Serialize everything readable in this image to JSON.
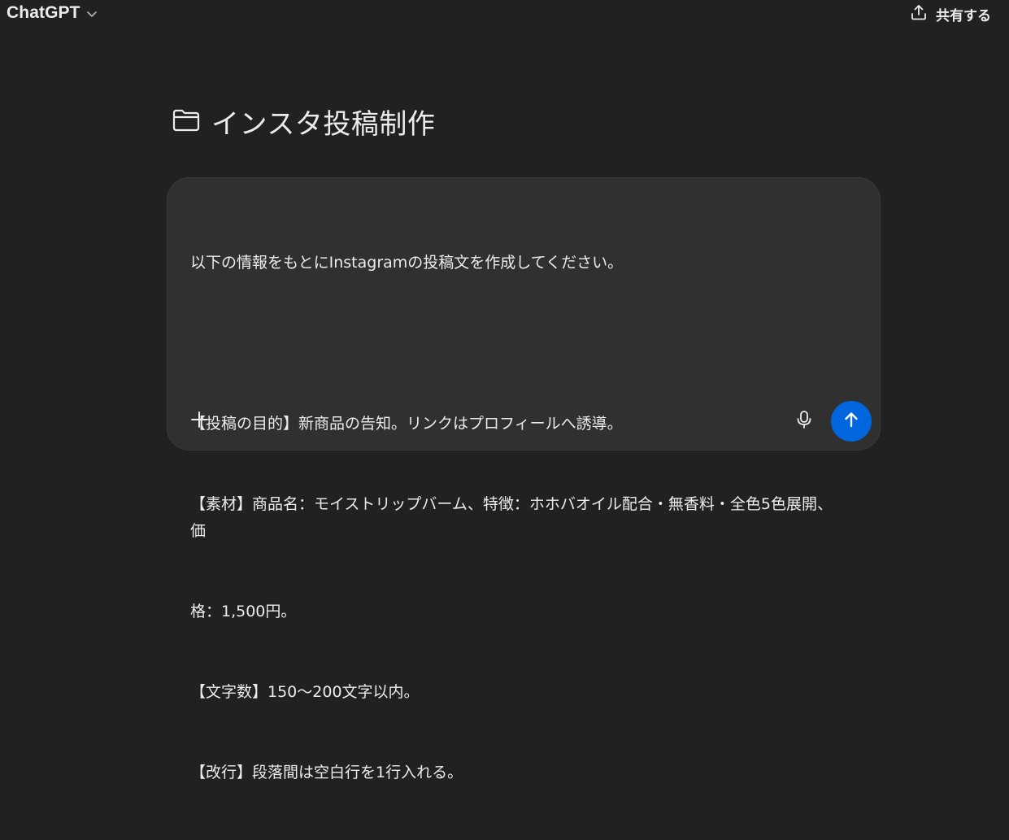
{
  "header": {
    "model_name": "ChatGPT",
    "share_label": "共有する"
  },
  "project": {
    "title": "インスタ投稿制作"
  },
  "composer": {
    "lines": [
      "以下の情報をもとにInstagramの投稿文を作成してください。",
      "",
      "【投稿の目的】新商品の告知。リンクはプロフィールへ誘導。",
      "【素材】商品名：モイストリップバーム、特徴：ホホバオイル配合・無香料・全色5色展開、価",
      "格：1,500円。",
      "【文字数】150〜200文字以内。",
      "【改行】段落間は空白行を1行入れる。"
    ]
  },
  "colors": {
    "background": "#212121",
    "composer": "#303030",
    "send_button": "#0066de",
    "text": "#ececec"
  },
  "icons": {
    "model_chevron": "chevron-down-icon",
    "share": "share-upload-icon",
    "project": "folder-icon",
    "add": "plus-icon",
    "mic": "microphone-icon",
    "send": "arrow-up-icon"
  }
}
